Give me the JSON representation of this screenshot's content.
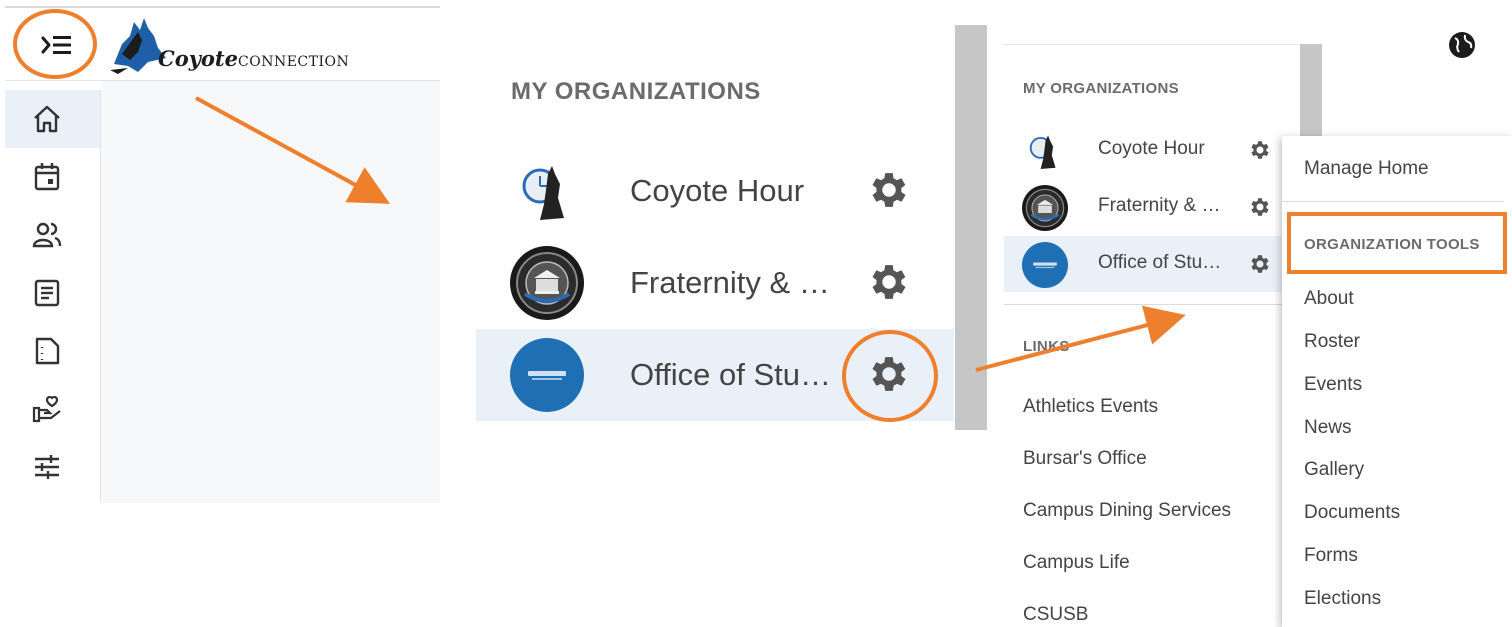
{
  "header": {
    "logo_script": "Coyote",
    "logo_caps": "CONNECTION"
  },
  "sidebar": {
    "items": [
      {
        "icon": "home-icon"
      },
      {
        "icon": "calendar-icon"
      },
      {
        "icon": "people-icon"
      },
      {
        "icon": "news-icon"
      },
      {
        "icon": "document-icon"
      },
      {
        "icon": "volunteer-icon"
      },
      {
        "icon": "tools-icon"
      }
    ]
  },
  "zoom": {
    "title": "MY ORGANIZATIONS",
    "orgs": [
      {
        "name": "Coyote Hour"
      },
      {
        "name": "Fraternity & …"
      },
      {
        "name": "Office of Stu…"
      }
    ]
  },
  "dropdown": {
    "title": "MY ORGANIZATIONS",
    "orgs": [
      {
        "name": "Coyote Hour"
      },
      {
        "name": "Fraternity & …"
      },
      {
        "name": "Office of Stu…"
      }
    ],
    "links_title": "LINKS",
    "links": [
      "Athletics Events",
      "Bursar's Office",
      "Campus Dining Services",
      "Campus Life",
      "CSUSB"
    ]
  },
  "popup": {
    "manage_home": "Manage Home",
    "section_title": "ORGANIZATION TOOLS",
    "tools": [
      "About",
      "Roster",
      "Events",
      "News",
      "Gallery",
      "Documents",
      "Forms",
      "Elections"
    ]
  },
  "colors": {
    "highlight": "#ee7f2d",
    "selected_row": "#eaf0f8",
    "org_blue": "#1f6fb5"
  }
}
